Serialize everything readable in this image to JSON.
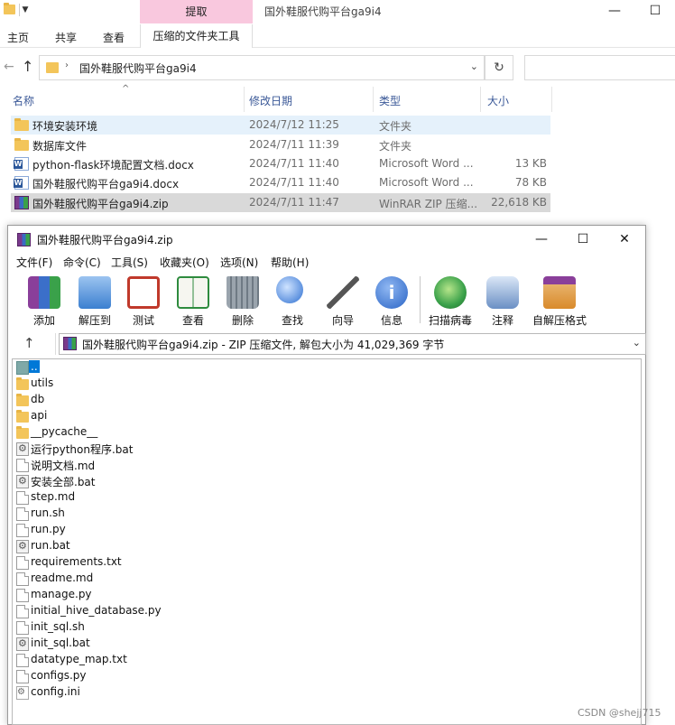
{
  "explorer": {
    "title": "国外鞋服代购平台ga9i4",
    "context_tab": "提取",
    "window_controls": {
      "minimize": "—",
      "maximize": "☐"
    },
    "ribbon_tabs": [
      "主页",
      "共享",
      "查看"
    ],
    "ribbon_active_tab": "压缩的文件夹工具",
    "nav": {
      "back": "←",
      "up": "↑",
      "refresh": "↻",
      "chevron": "⌄"
    },
    "address": "国外鞋服代购平台ga9i4",
    "columns": {
      "name": "名称",
      "modified": "修改日期",
      "type": "类型",
      "size": "大小"
    },
    "files": [
      {
        "name": "环境安装环境",
        "date": "2024/7/12 11:25",
        "type": "文件夹",
        "size": "",
        "icon": "folder-icon"
      },
      {
        "name": "数据库文件",
        "date": "2024/7/11 11:39",
        "type": "文件夹",
        "size": "",
        "icon": "folder-icon"
      },
      {
        "name": "python-flask环境配置文档.docx",
        "date": "2024/7/11 11:40",
        "type": "Microsoft Word ...",
        "size": "13 KB",
        "icon": "word-doc-icon"
      },
      {
        "name": "国外鞋服代购平台ga9i4.docx",
        "date": "2024/7/11 11:40",
        "type": "Microsoft Word ...",
        "size": "78 KB",
        "icon": "word-doc-icon"
      },
      {
        "name": "国外鞋服代购平台ga9i4.zip",
        "date": "2024/7/11 11:47",
        "type": "WinRAR ZIP 压缩...",
        "size": "22,618 KB",
        "icon": "winrar-zip-icon"
      }
    ]
  },
  "winrar": {
    "title": "国外鞋服代购平台ga9i4.zip",
    "window_controls": {
      "minimize": "—",
      "maximize": "☐",
      "close": "✕"
    },
    "menu": [
      "文件(F)",
      "命令(C)",
      "工具(S)",
      "收藏夹(O)",
      "选项(N)",
      "帮助(H)"
    ],
    "toolbar": [
      {
        "label": "添加",
        "icon": "add-archive-icon",
        "color": "#8a3f9a"
      },
      {
        "label": "解压到",
        "icon": "extract-to-icon",
        "color": "#3b7fd0"
      },
      {
        "label": "测试",
        "icon": "test-icon",
        "color": "#c0392b"
      },
      {
        "label": "查看",
        "icon": "view-book-icon",
        "color": "#2e8b3e"
      },
      {
        "label": "删除",
        "icon": "trash-icon",
        "color": "#7b8794"
      },
      {
        "label": "查找",
        "icon": "magnifier-icon",
        "color": "#2d6fd1"
      },
      {
        "label": "向导",
        "icon": "wizard-wand-icon",
        "color": "#555555"
      },
      {
        "label": "信息",
        "icon": "info-icon",
        "color": "#2a64c5"
      },
      {
        "label": "扫描病毒",
        "icon": "virus-scan-icon",
        "color": "#3aa14a"
      },
      {
        "label": "注释",
        "icon": "comment-icon",
        "color": "#6a8fc4"
      },
      {
        "label": "自解压格式",
        "icon": "sfx-box-icon",
        "color": "#d98a2b"
      }
    ],
    "path": "国外鞋服代购平台ga9i4.zip - ZIP 压缩文件, 解包大小为 41,029,369 字节",
    "entries": [
      {
        "name": "..",
        "kind": "up"
      },
      {
        "name": "utils",
        "kind": "folder"
      },
      {
        "name": "db",
        "kind": "folder"
      },
      {
        "name": "api",
        "kind": "folder"
      },
      {
        "name": "__pycache__",
        "kind": "folder"
      },
      {
        "name": "运行python程序.bat",
        "kind": "bat"
      },
      {
        "name": "说明文档.md",
        "kind": "file"
      },
      {
        "name": "安装全部.bat",
        "kind": "bat"
      },
      {
        "name": "step.md",
        "kind": "file"
      },
      {
        "name": "run.sh",
        "kind": "file"
      },
      {
        "name": "run.py",
        "kind": "file"
      },
      {
        "name": "run.bat",
        "kind": "bat"
      },
      {
        "name": "requirements.txt",
        "kind": "file"
      },
      {
        "name": "readme.md",
        "kind": "file"
      },
      {
        "name": "manage.py",
        "kind": "file"
      },
      {
        "name": "initial_hive_database.py",
        "kind": "file"
      },
      {
        "name": "init_sql.sh",
        "kind": "file"
      },
      {
        "name": "init_sql.bat",
        "kind": "bat"
      },
      {
        "name": "datatype_map.txt",
        "kind": "file"
      },
      {
        "name": "configs.py",
        "kind": "file"
      },
      {
        "name": "config.ini",
        "kind": "ini"
      }
    ]
  },
  "watermark": "CSDN @shejj715"
}
